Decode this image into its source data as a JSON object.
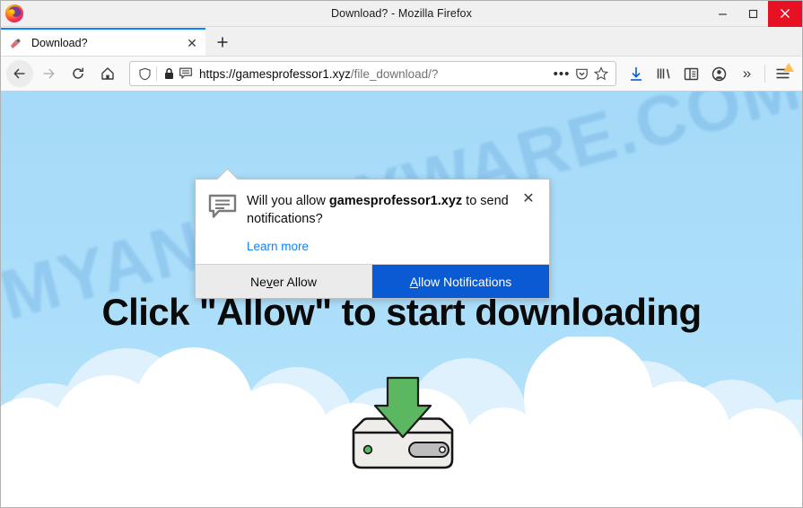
{
  "window": {
    "title": "Download? - Mozilla Firefox",
    "app_icon": "firefox-logo",
    "minimize_label": "–",
    "maximize_label": "□",
    "close_label": "×"
  },
  "tabs": {
    "items": [
      {
        "title": "Download?",
        "favicon": "page-favicon",
        "close_label": "✕"
      }
    ],
    "new_tab_label": "+"
  },
  "navigation": {
    "back_label": "back-arrow",
    "forward_label": "forward-arrow",
    "reload_label": "reload-arrow",
    "home_label": "home-house"
  },
  "urlbar": {
    "shield_icon": "tracking-protection-shield",
    "lock_icon": "padlock",
    "notification_icon": "notification-bubble",
    "url_visible": "https://gamesprofessor1.xyz",
    "url_path": "/file_download/?",
    "page_actions_label": "•••",
    "pocket_icon": "pocket-shield",
    "bookmark_icon": "star-outline"
  },
  "toolbar": {
    "downloads_icon": "downloads-arrow",
    "library_icon": "library-books",
    "sidebar_icon": "sidebar-panel",
    "account_icon": "account-avatar",
    "overflow_label": "»",
    "menu_icon": "hamburger-menu",
    "menu_badge": "update-warning-triangle"
  },
  "notification_dialog": {
    "icon": "speech-bubble-notification",
    "question_prefix": "Will you allow ",
    "question_domain": "gamesprofessor1.xyz",
    "question_suffix": " to send notifications?",
    "learn_more": "Learn more",
    "close_label": "✕",
    "never_allow": {
      "before": "Ne",
      "accesskey": "v",
      "after": "er Allow"
    },
    "allow": {
      "accesskey": "A",
      "after": "llow Notifications"
    }
  },
  "page": {
    "headline": "Click \"Allow\" to start downloading",
    "watermark": "MYANTISPYWARE.COM",
    "graphic": "download-to-drive-illustration",
    "colors": {
      "sky": "#a9dcf9",
      "cloud_front": "#ffffff",
      "cloud_back": "#dcf0fd",
      "arrow_green": "#5cb860",
      "arrow_green_dark": "#3f9e48",
      "drive_body": "#efedea",
      "drive_outline": "#1a1a1a",
      "drive_led": "#5cb860",
      "drive_slot": "#b8b8b8",
      "headline": "#0a0a0a",
      "primary_button": "#0a5bd3",
      "link": "#0a84ff",
      "close_button": "#e81123",
      "tab_accent": "#0a84ff"
    }
  }
}
